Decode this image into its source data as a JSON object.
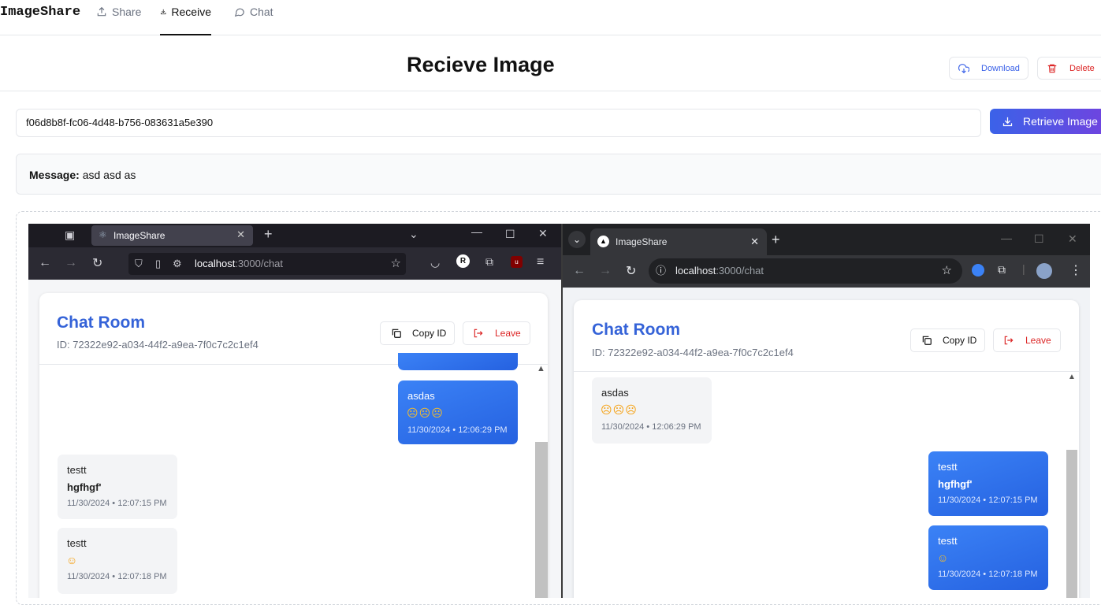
{
  "nav": {
    "brand": "ImageShare",
    "tabs": [
      {
        "label": "Share",
        "icon": "upload-icon"
      },
      {
        "label": "Receive",
        "icon": "download-icon",
        "active": true
      },
      {
        "label": "Chat",
        "icon": "chat-bubble-icon"
      }
    ]
  },
  "header": {
    "title": "Recieve Image",
    "download_label": "Download",
    "delete_label": "Delete"
  },
  "retrieve": {
    "id_value": "f06d8b8f-fc06-4d48-b756-083631a5e390",
    "button_label": "Retrieve Image"
  },
  "message": {
    "label": "Message:",
    "text": "asd asd as"
  },
  "screenshot": {
    "left": {
      "tab_title": "ImageShare",
      "url_host": "localhost",
      "url_path": ":3000/chat",
      "chat_title": "Chat Room",
      "chat_id": "ID: 72322e92-a034-44f2-a9ea-7f0c7c2c1ef4",
      "copy_label": "Copy ID",
      "leave_label": "Leave",
      "messages": [
        {
          "user": "asdas",
          "emoji": "☹☹☹",
          "time": "11/30/2024 • 12:06:29 PM",
          "mine": true
        },
        {
          "user": "testt",
          "text": "hgfhgf'",
          "time": "11/30/2024 • 12:07:15 PM",
          "mine": false
        },
        {
          "user": "testt",
          "emoji": "☺",
          "time": "11/30/2024 • 12:07:18 PM",
          "mine": false
        }
      ]
    },
    "right": {
      "tab_title": "ImageShare",
      "url_host": "localhost",
      "url_path": ":3000/chat",
      "chat_title": "Chat Room",
      "chat_id": "ID: 72322e92-a034-44f2-a9ea-7f0c7c2c1ef4",
      "copy_label": "Copy ID",
      "leave_label": "Leave",
      "messages": [
        {
          "user": "asdas",
          "emoji": "☹☹☹",
          "time": "11/30/2024 • 12:06:29 PM",
          "mine": false
        },
        {
          "user": "testt",
          "text": "hgfhgf'",
          "time": "11/30/2024 • 12:07:15 PM",
          "mine": true
        },
        {
          "user": "testt",
          "emoji": "☺",
          "time": "11/30/2024 • 12:07:18 PM",
          "mine": true
        }
      ]
    }
  },
  "colors": {
    "accent": "#3b62e8",
    "accent_end": "#6d45e0",
    "delete": "#dc2626",
    "chat_title": "#3563d8"
  }
}
